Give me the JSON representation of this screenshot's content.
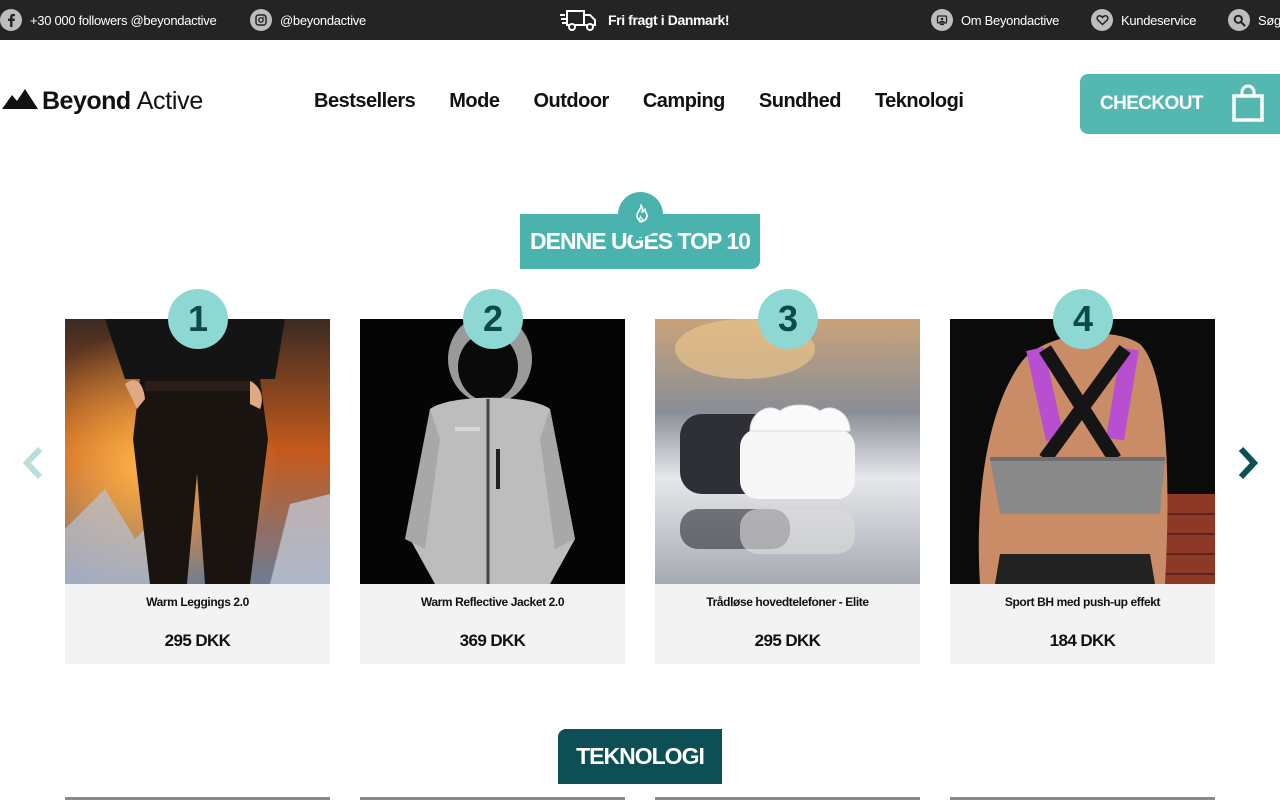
{
  "topbar": {
    "facebook": "+30 000 followers @beyondactive",
    "instagram": "@beyondactive",
    "free_shipping": "Fri fragt i Danmark!",
    "about": "Om Beyondactive",
    "service": "Kundeservice",
    "search": "Søg"
  },
  "header": {
    "logo_bold": "Beyond",
    "logo_light": "Active",
    "nav": [
      "Bestsellers",
      "Mode",
      "Outdoor",
      "Camping",
      "Sundhed",
      "Teknologi"
    ],
    "checkout": "CHECKOUT"
  },
  "top10": {
    "title": "DENNE UGES TOP 10",
    "products": [
      {
        "rank": "1",
        "name": "Warm Leggings 2.0",
        "price": "295 DKK"
      },
      {
        "rank": "2",
        "name": "Warm Reflective Jacket 2.0",
        "price": "369 DKK"
      },
      {
        "rank": "3",
        "name": "Trådløse hovedtelefoner - Elite",
        "price": "295 DKK"
      },
      {
        "rank": "4",
        "name": "Sport BH med push-up effekt",
        "price": "184 DKK"
      }
    ]
  },
  "next_section": {
    "title": "TEKNOLOGI"
  },
  "colors": {
    "teal": "#4ab3ad",
    "rank_circle": "#8ed8d3",
    "dark_teal": "#0d4f54",
    "topbar": "#242424"
  },
  "icons": [
    "facebook-icon",
    "instagram-icon",
    "truck-icon",
    "about-icon",
    "heart-icon",
    "search-icon",
    "bag-icon",
    "flame-icon",
    "chevron-left-icon",
    "chevron-right-icon"
  ]
}
